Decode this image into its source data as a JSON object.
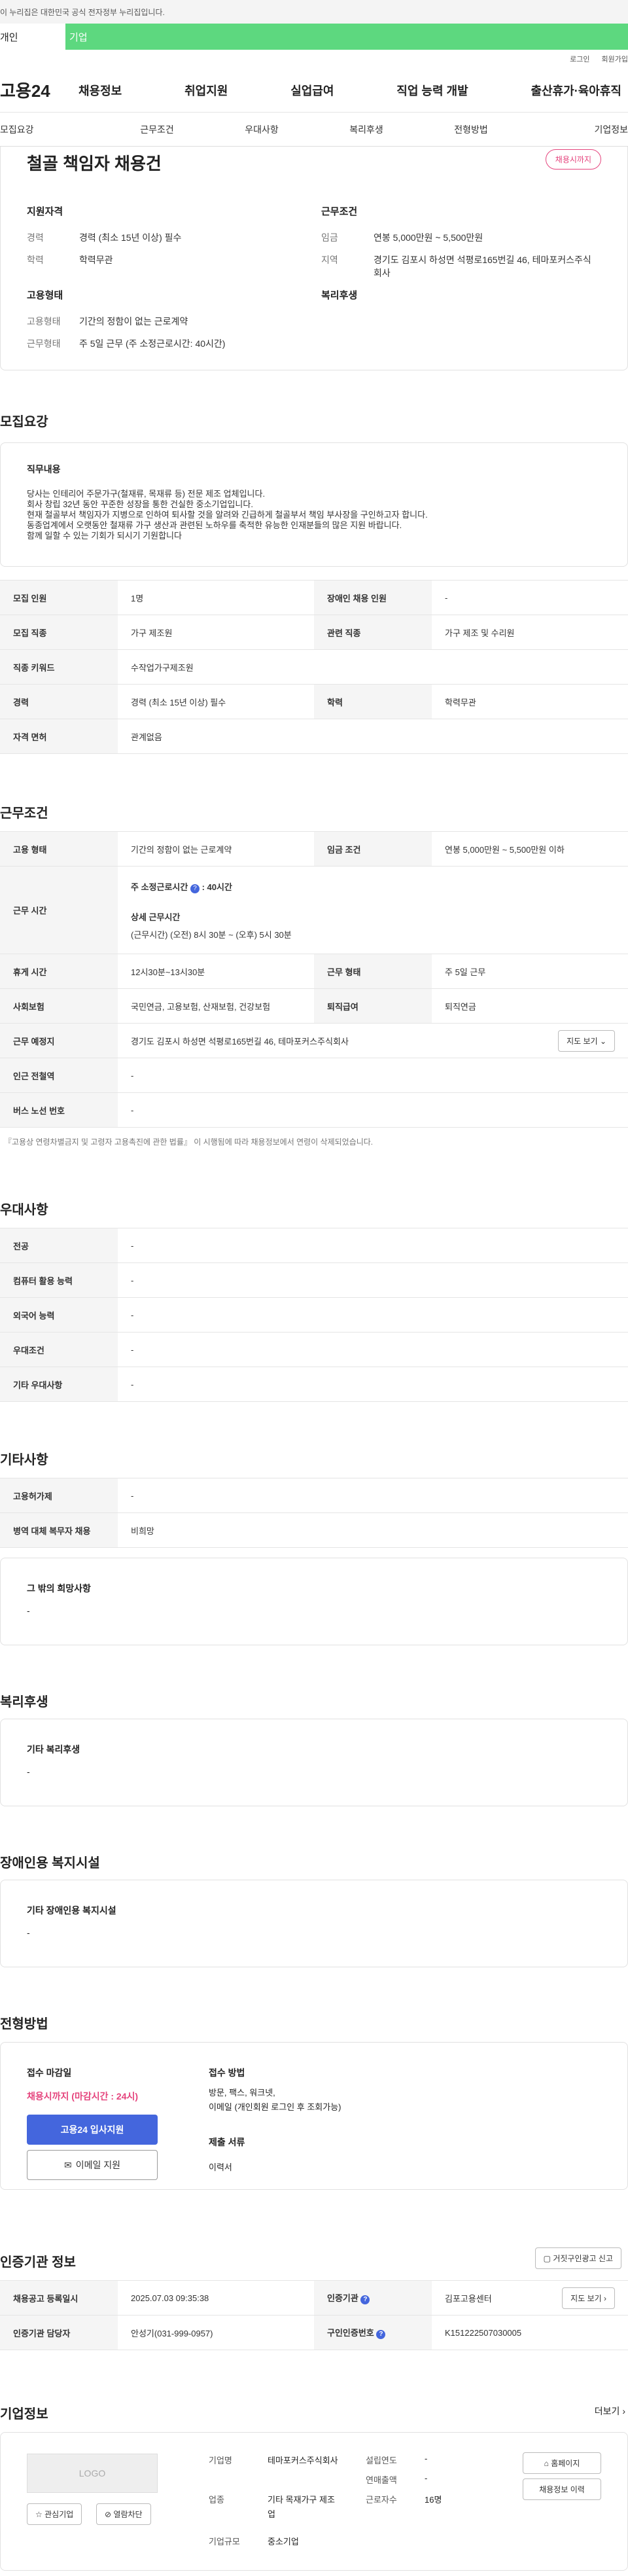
{
  "top": {
    "gov_notice": "이 누리집은 대한민국 공식 전자정부 누리집입니다.",
    "type_personal": "개인",
    "type_company": "기업"
  },
  "util": {
    "login": "로그인",
    "join": "회원가입"
  },
  "gnb": {
    "logo": "고용24",
    "menu": [
      "채용정보",
      "취업지원",
      "실업급여",
      "직업 능력 개발",
      "출산휴가·육아휴직"
    ]
  },
  "tabs": [
    "모집요강",
    "근무조건",
    "우대사항",
    "복리후생",
    "전형방법",
    "기업정보"
  ],
  "job": {
    "title": "철골 책임자 채용건",
    "status": "채용시까지",
    "summary": {
      "qual_h": "지원자격",
      "exp_k": "경력",
      "exp_v": "경력 (최소 15년 이상) 필수",
      "edu_k": "학력",
      "edu_v": "학력무관",
      "emp_h": "고용형태",
      "emp_k": "고용형태",
      "emp_v": "기간의 정함이 없는 근로계약",
      "work_k": "근무형태",
      "work_v": "주 5일 근무 (주 소정근로시간: 40시간)",
      "cond_h": "근무조건",
      "wage_k": "임금",
      "wage_v": "연봉 5,000만원 ~ 5,500만원",
      "area_k": "지역",
      "area_v": "경기도 김포시 하성면 석평로165번길 46, 테마포커스주식회사",
      "welfare_h": "복리후생"
    }
  },
  "recruit": {
    "title": "모집요강",
    "duty_h": "직무내용",
    "duty_lines": [
      "당사는 인테리어 주문가구(철재류, 목재류 등) 전문 제조 업체입니다.",
      "회사 창립 32년 동안 꾸준한 성장을 통한 건실한 중소기업입니다.",
      "현재 철골부서 책임자가 지병으로 인하여 퇴사할 것을 알려와 긴급하게 철골부서 책임 부사장을 구인하고자 합니다.",
      "동종업계에서 오랫동안 철재류 가구 생산과 관련된 노하우를 축적한  유능한 인재분들의 많은 지원 바랍니다.",
      "함께 일할 수 있는 기회가 되시기 기원합니다"
    ],
    "rows": [
      [
        "모집 인원",
        "1명",
        "장애인 채용 인원",
        "-"
      ],
      [
        "모집 직종",
        "가구 제조원",
        "관련 직종",
        "가구 제조 및 수리원"
      ],
      [
        "직종 키워드",
        "수작업가구제조원",
        "",
        ""
      ],
      [
        "경력",
        "경력 (최소 15년 이상) 필수",
        "학력",
        "학력무관"
      ],
      [
        "자격 면허",
        "관계없음",
        "",
        ""
      ]
    ]
  },
  "cond": {
    "title": "근무조건",
    "emp_k": "고용 형태",
    "emp_v": "기간의 정함이 없는 근로계약",
    "wage_k": "임금 조건",
    "wage_v": "연봉 5,000만원 ~ 5,500만원 이하",
    "hours_k": "근무 시간",
    "hours_week": "주 소정근로시간",
    "hours_week_val": ": 40시간",
    "hours_detail_h": "상세 근무시간",
    "hours_detail": "(근무시간) (오전) 8시 30분 ~ (오후) 5시 30분",
    "break_k": "휴게 시간",
    "break_v": "12시30분~13시30분",
    "wtype_k": "근무 형태",
    "wtype_v": "주 5일 근무",
    "ins_k": "사회보험",
    "ins_v": "국민연금, 고용보험, 산재보험, 건강보험",
    "sev_k": "퇴직급여",
    "sev_v": "퇴직연금",
    "loc_k": "근무 예정지",
    "loc_v": "경기도 김포시 하성면 석평로165번길 46, 테마포커스주식회사",
    "map_btn": "지도 보기",
    "sub_k": "인근 전철역",
    "sub_v": "-",
    "bus_k": "버스 노선 번호",
    "bus_v": "-",
    "note": "『고용상 연령차별금지 및 고령자 고용촉진에 관한 법률』 이 시행됨에 따라 채용정보에서 연령이 삭제되었습니다."
  },
  "pref": {
    "title": "우대사항",
    "rows": [
      [
        "전공",
        "-"
      ],
      [
        "컴퓨터 활용 능력",
        "-"
      ],
      [
        "외국어 능력",
        "-"
      ],
      [
        "우대조건",
        "-"
      ],
      [
        "기타 우대사항",
        "-"
      ]
    ]
  },
  "etc": {
    "title": "기타사항",
    "rows": [
      [
        "고용허가제",
        "-"
      ],
      [
        "병역 대체 복무자 채용",
        "비희망"
      ]
    ],
    "extra_h": "그 밖의 희망사항",
    "extra_v": "-"
  },
  "welfare": {
    "title": "복리후생",
    "h": "기타 복리후생",
    "v": "-"
  },
  "disabled": {
    "title": "장애인용 복지시설",
    "h": "기타 장애인용 복지시설",
    "v": "-"
  },
  "process": {
    "title": "전형방법",
    "deadline_h": "접수 마감일",
    "deadline_v": "채용시까지 (마감시간 : 24시)",
    "apply_btn": "고용24 입사지원",
    "email_btn": "이메일 지원",
    "method_h": "접수 방법",
    "method_v1": "방문, 팩스, 워크넷,",
    "method_v2": "이메일 (개인회원 로그인 후 조회가능)",
    "docs_h": "제출 서류",
    "docs_v": "이력서"
  },
  "cert": {
    "title": "인증기관 정보",
    "report_btn": "거짓구인광고 신고",
    "reg_k": "채용공고 등록일시",
    "reg_v": "2025.07.03 09:35:38",
    "org_k": "인증기관",
    "org_v": "김포고용센터",
    "map_btn": "지도 보기",
    "mgr_k": "인증기관 담당자",
    "mgr_v": "안성기(031-999-0957)",
    "no_k": "구인인증번호",
    "no_v": "K151222507030005"
  },
  "company": {
    "title": "기업정보",
    "more": "더보기",
    "logo": "LOGO",
    "fav": "관심기업",
    "block": "열람차단",
    "name_k": "기업명",
    "name_v": "테마포커스주식회사",
    "ind_k": "업종",
    "ind_v": "기타 목재가구 제조업",
    "size_k": "기업규모",
    "size_v": "중소기업",
    "est_k": "설립연도",
    "est_v": "-",
    "sales_k": "연매출액",
    "sales_v": "-",
    "emp_k": "근로자수",
    "emp_v": "16명",
    "home_btn": "홈페이지",
    "hist_btn": "채용정보 이력"
  },
  "colors": {
    "accent": "#5dd87f",
    "badge": "#e5447d",
    "primary": "#4466dd",
    "deadline": "#e5447d"
  }
}
